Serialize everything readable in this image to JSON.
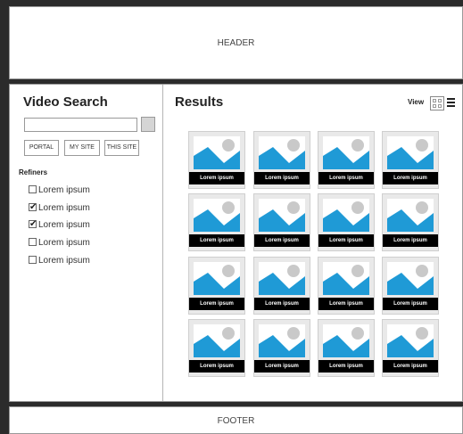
{
  "header": {
    "label": "HEADER"
  },
  "footer": {
    "label": "FOOTER"
  },
  "sidebar": {
    "title": "Video Search",
    "search": {
      "value": "",
      "placeholder": ""
    },
    "scopes": [
      "PORTAL",
      "MY SITE",
      "THIS SITE"
    ],
    "refiners_label": "Refiners",
    "refiners": [
      {
        "label": "Lorem ipsum",
        "checked": false
      },
      {
        "label": "Lorem ipsum",
        "checked": true
      },
      {
        "label": "Lorem ipsum",
        "checked": true
      },
      {
        "label": "Lorem ipsum",
        "checked": false
      },
      {
        "label": "Lorem ipsum",
        "checked": false
      }
    ]
  },
  "results": {
    "title": "Results",
    "view_label": "View",
    "items": [
      "Lorem ipsum",
      "Lorem ipsum",
      "Lorem ipsum",
      "Lorem ipsum",
      "Lorem ipsum",
      "Lorem ipsum",
      "Lorem ipsum",
      "Lorem ipsum",
      "Lorem ipsum",
      "Lorem ipsum",
      "Lorem ipsum",
      "Lorem ipsum",
      "Lorem ipsum",
      "Lorem ipsum",
      "Lorem ipsum",
      "Lorem ipsum"
    ]
  },
  "colors": {
    "mountain": "#1f9ad6",
    "caption_bg": "#000000"
  }
}
